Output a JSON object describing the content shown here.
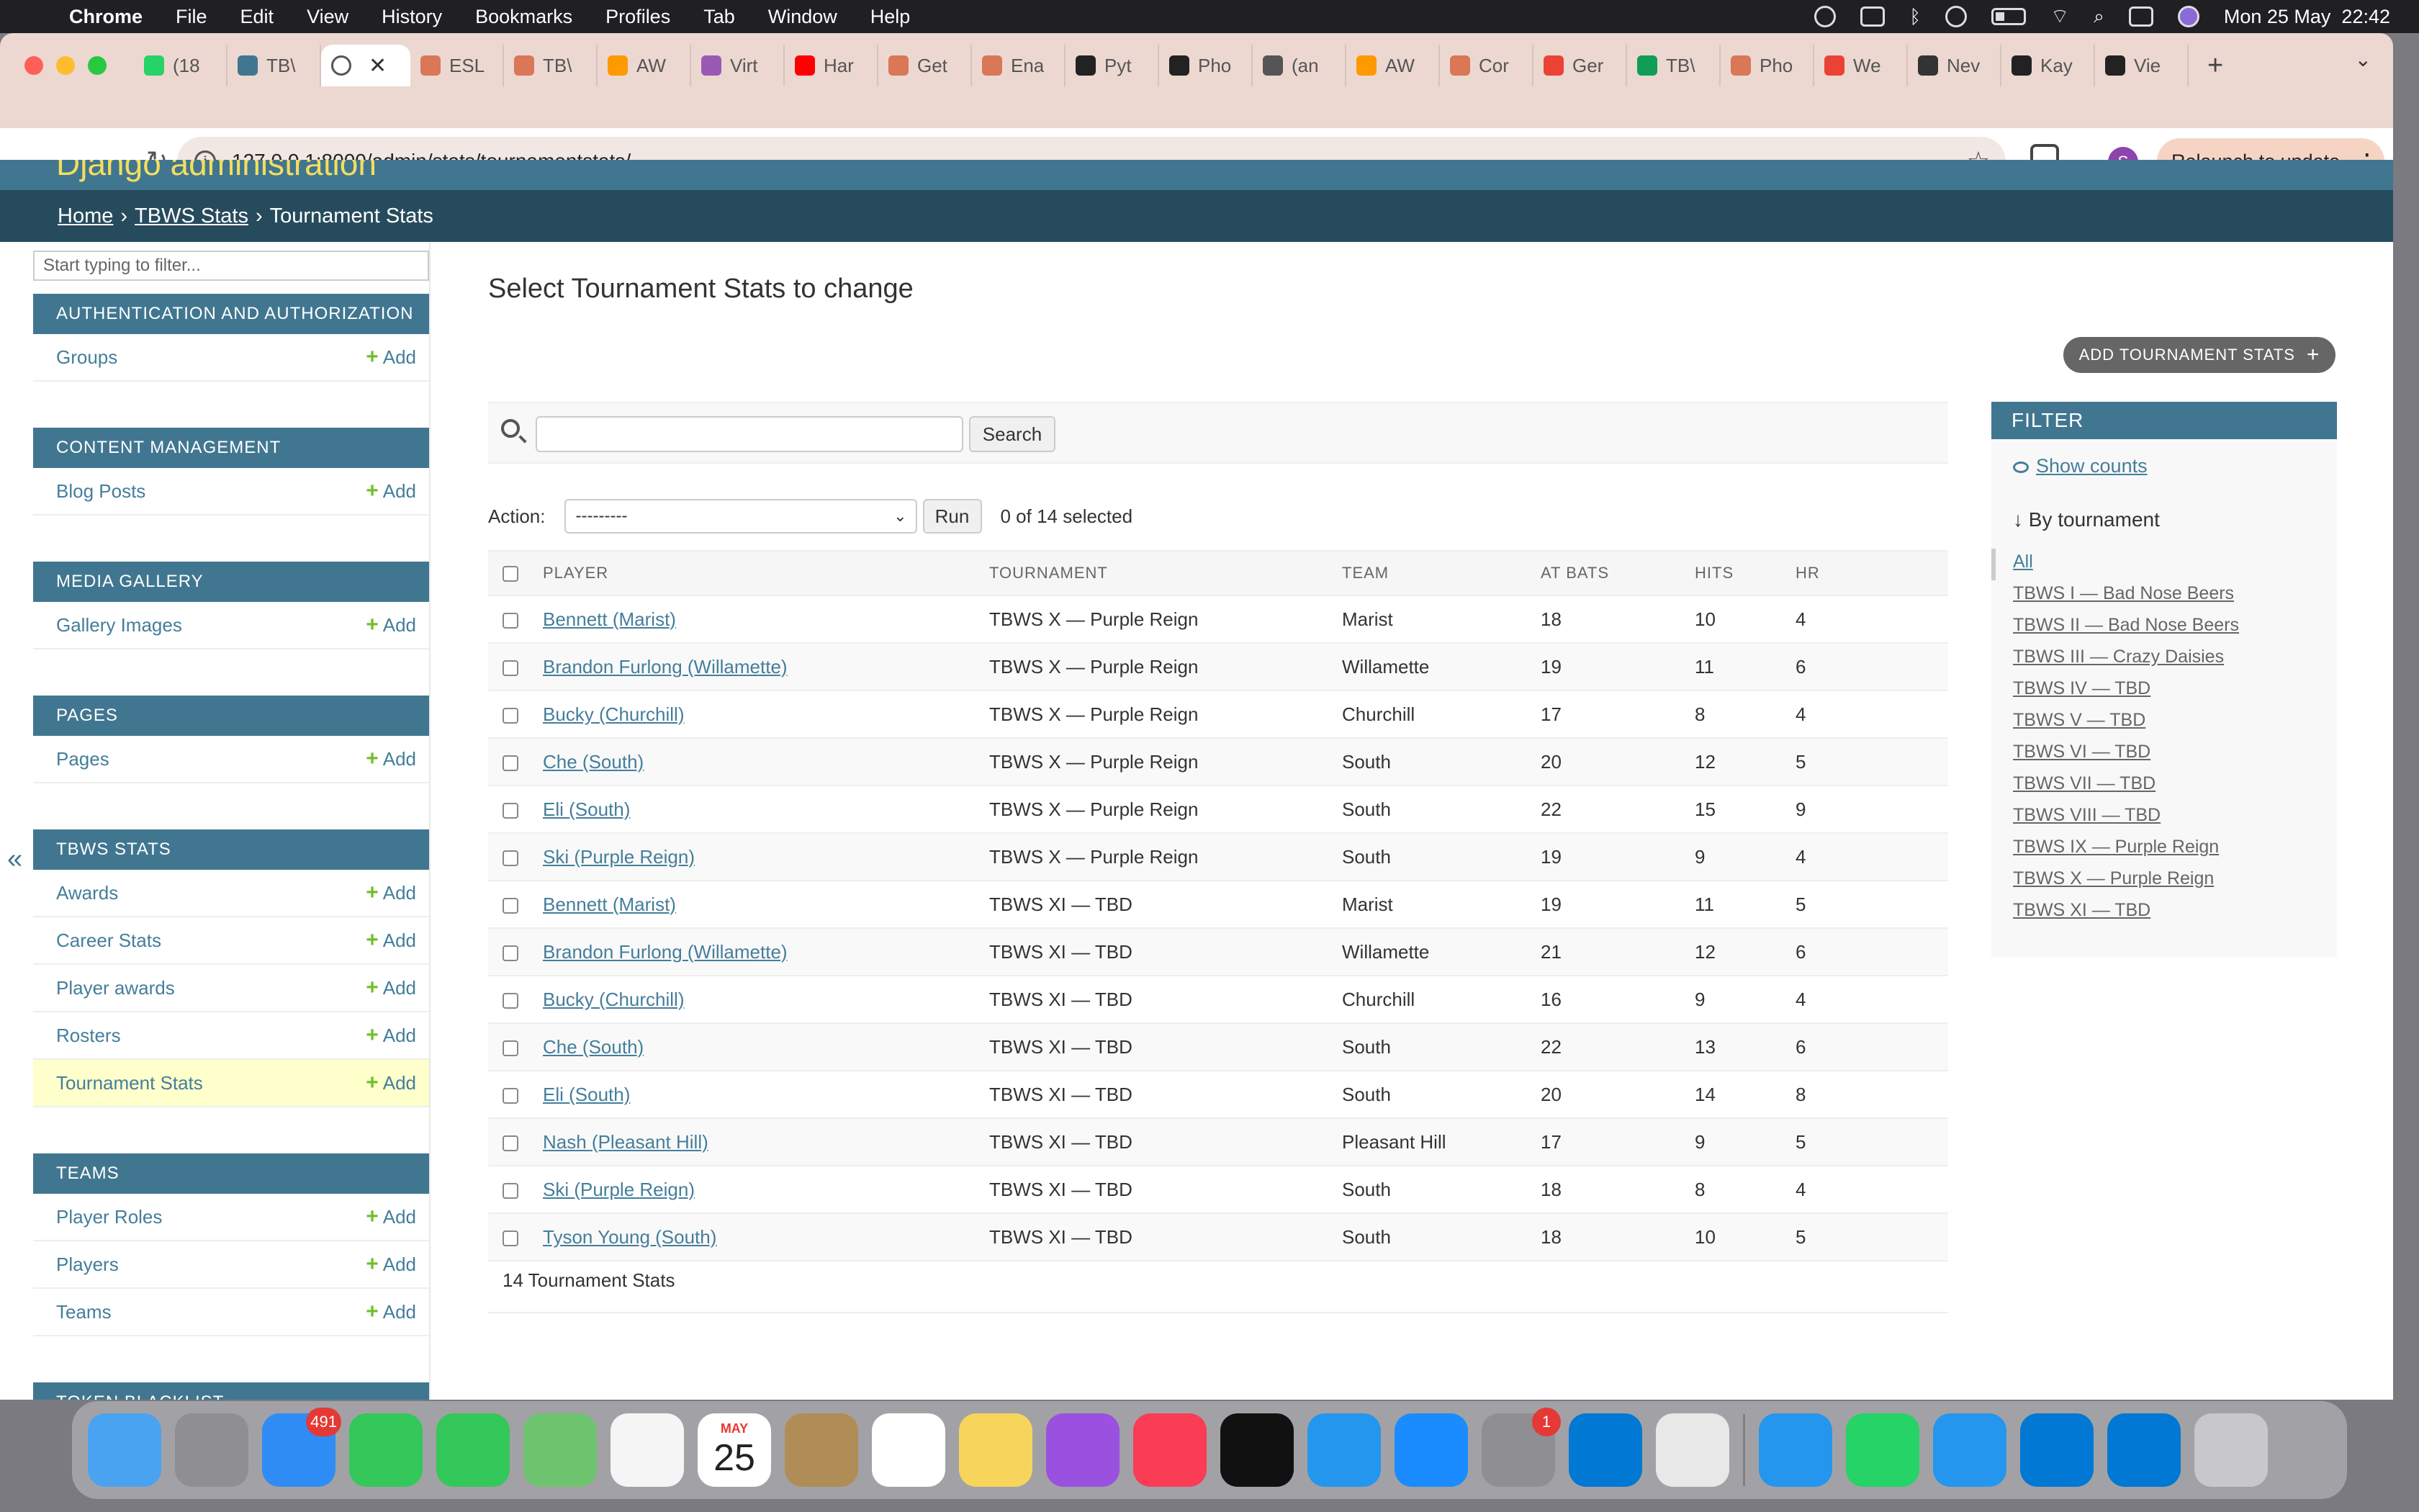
{
  "menubar": {
    "app": "Chrome",
    "items": [
      "File",
      "Edit",
      "View",
      "History",
      "Bookmarks",
      "Profiles",
      "Tab",
      "Window",
      "Help"
    ],
    "datetime": "Mon 25 May  22:42"
  },
  "browser": {
    "tabs": [
      {
        "label": "(18",
        "color": "#25d366"
      },
      {
        "label": "TB\\",
        "color": "#417690"
      },
      {
        "label": "",
        "color": "#888",
        "active": true
      },
      {
        "label": "ESL",
        "color": "#d97757"
      },
      {
        "label": "TB\\",
        "color": "#d97757"
      },
      {
        "label": "AW",
        "color": "#ff9900"
      },
      {
        "label": "Virt",
        "color": "#9b59b6"
      },
      {
        "label": "Har",
        "color": "#ff0000"
      },
      {
        "label": "Get",
        "color": "#d97757"
      },
      {
        "label": "Ena",
        "color": "#d97757"
      },
      {
        "label": "Pyt",
        "color": "#222"
      },
      {
        "label": "Pho",
        "color": "#222"
      },
      {
        "label": "(an",
        "color": "#555"
      },
      {
        "label": "AW",
        "color": "#ff9900"
      },
      {
        "label": "Cor",
        "color": "#d97757"
      },
      {
        "label": "Ger",
        "color": "#ea4335"
      },
      {
        "label": "TB\\",
        "color": "#0f9d58"
      },
      {
        "label": "Pho",
        "color": "#d97757"
      },
      {
        "label": "We",
        "color": "#ea4335"
      },
      {
        "label": "Nev",
        "color": "#333"
      },
      {
        "label": "Kay",
        "color": "#222"
      },
      {
        "label": "Vie",
        "color": "#222"
      }
    ],
    "url": "127.0.0.1:8000/admin/stats/tournamentstats/",
    "profile_initial": "S",
    "relaunch_label": "Relaunch to update"
  },
  "admin": {
    "brand": "Django administration",
    "breadcrumbs": {
      "home": "Home",
      "app": "TBWS Stats",
      "current": "Tournament Stats",
      "sep": "›"
    },
    "nav_filter_placeholder": "Start typing to filter...",
    "add_label": "Add",
    "modules": [
      {
        "caption": "Authentication and Authorization",
        "models": [
          "Groups"
        ]
      },
      {
        "caption": "Content Management",
        "models": [
          "Blog Posts"
        ]
      },
      {
        "caption": "Media Gallery",
        "models": [
          "Gallery Images"
        ]
      },
      {
        "caption": "Pages",
        "models": [
          "Pages"
        ]
      },
      {
        "caption": "TBWS Stats",
        "models": [
          "Awards",
          "Career Stats",
          "Player awards",
          "Rosters",
          "Tournament Stats"
        ],
        "selected": "Tournament Stats"
      },
      {
        "caption": "Teams",
        "models": [
          "Player Roles",
          "Players",
          "Teams"
        ]
      },
      {
        "caption": "Token Blacklist",
        "models": []
      }
    ],
    "page_title": "Select Tournament Stats to change",
    "add_button": "ADD TOURNAMENT STATS",
    "search_button": "Search",
    "action_label": "Action:",
    "action_value": "---------",
    "run_button": "Run",
    "selected_text": "0 of 14 selected",
    "columns": [
      "PLAYER",
      "TOURNAMENT",
      "TEAM",
      "AT BATS",
      "HITS",
      "HR"
    ],
    "rows": [
      [
        "Bennett (Marist)",
        "TBWS X — Purple Reign",
        "Marist",
        "18",
        "10",
        "4"
      ],
      [
        "Brandon Furlong (Willamette)",
        "TBWS X — Purple Reign",
        "Willamette",
        "19",
        "11",
        "6"
      ],
      [
        "Bucky (Churchill)",
        "TBWS X — Purple Reign",
        "Churchill",
        "17",
        "8",
        "4"
      ],
      [
        "Che (South)",
        "TBWS X — Purple Reign",
        "South",
        "20",
        "12",
        "5"
      ],
      [
        "Eli (South)",
        "TBWS X — Purple Reign",
        "South",
        "22",
        "15",
        "9"
      ],
      [
        "Ski (Purple Reign)",
        "TBWS X — Purple Reign",
        "South",
        "19",
        "9",
        "4"
      ],
      [
        "Bennett (Marist)",
        "TBWS XI — TBD",
        "Marist",
        "19",
        "11",
        "5"
      ],
      [
        "Brandon Furlong (Willamette)",
        "TBWS XI — TBD",
        "Willamette",
        "21",
        "12",
        "6"
      ],
      [
        "Bucky (Churchill)",
        "TBWS XI — TBD",
        "Churchill",
        "16",
        "9",
        "4"
      ],
      [
        "Che (South)",
        "TBWS XI — TBD",
        "South",
        "22",
        "13",
        "6"
      ],
      [
        "Eli (South)",
        "TBWS XI — TBD",
        "South",
        "20",
        "14",
        "8"
      ],
      [
        "Nash (Pleasant Hill)",
        "TBWS XI — TBD",
        "Pleasant Hill",
        "17",
        "9",
        "5"
      ],
      [
        "Ski (Purple Reign)",
        "TBWS XI — TBD",
        "South",
        "18",
        "8",
        "4"
      ],
      [
        "Tyson Young (South)",
        "TBWS XI — TBD",
        "South",
        "18",
        "10",
        "5"
      ]
    ],
    "paginator": "14 Tournament Stats",
    "filter": {
      "caption": "FILTER",
      "show_counts": "Show counts",
      "by_tournament": "↓ By tournament",
      "choices": [
        "All",
        "TBWS I — Bad Nose Beers",
        "TBWS II — Bad Nose Beers",
        "TBWS III — Crazy Daisies",
        "TBWS IV — TBD",
        "TBWS V — TBD",
        "TBWS VI — TBD",
        "TBWS VII — TBD",
        "TBWS VIII — TBD",
        "TBWS IX — Purple Reign",
        "TBWS X — Purple Reign",
        "TBWS XI — TBD"
      ],
      "selected": "All"
    }
  },
  "dock": {
    "apps": [
      {
        "name": "finder",
        "color": "#4aa3f0"
      },
      {
        "name": "launchpad",
        "color": "#8e8e93"
      },
      {
        "name": "mail",
        "color": "#2f8cf5",
        "badge": "491"
      },
      {
        "name": "facetime",
        "color": "#34c759"
      },
      {
        "name": "messages",
        "color": "#34c759"
      },
      {
        "name": "maps",
        "color": "#6ec36e"
      },
      {
        "name": "photos",
        "color": "#f5f5f5"
      },
      {
        "name": "calendar",
        "calendar": true,
        "month": "MAY",
        "day": "25"
      },
      {
        "name": "contacts",
        "color": "#b08d57"
      },
      {
        "name": "reminders",
        "color": "#ffffff"
      },
      {
        "name": "notes",
        "color": "#f7d55c"
      },
      {
        "name": "podcasts",
        "color": "#9b51e0"
      },
      {
        "name": "music",
        "color": "#fa3c55"
      },
      {
        "name": "tv",
        "color": "#111111"
      },
      {
        "name": "docker",
        "color": "#2496ed"
      },
      {
        "name": "app-store",
        "color": "#1a8cff"
      },
      {
        "name": "system-settings",
        "color": "#8e8e93",
        "badge": "1"
      },
      {
        "name": "vscode",
        "color": "#0078d4"
      },
      {
        "name": "chrome",
        "color": "#e8e8e8"
      },
      {
        "sep": true
      },
      {
        "name": "docker",
        "color": "#2496ed"
      },
      {
        "name": "whatsapp",
        "color": "#25d366"
      },
      {
        "name": "docker",
        "color": "#2496ed"
      },
      {
        "name": "vscode",
        "color": "#0078d4"
      },
      {
        "name": "vscode",
        "color": "#0078d4"
      },
      {
        "name": "trash",
        "color": "#c7c7cc"
      }
    ]
  }
}
